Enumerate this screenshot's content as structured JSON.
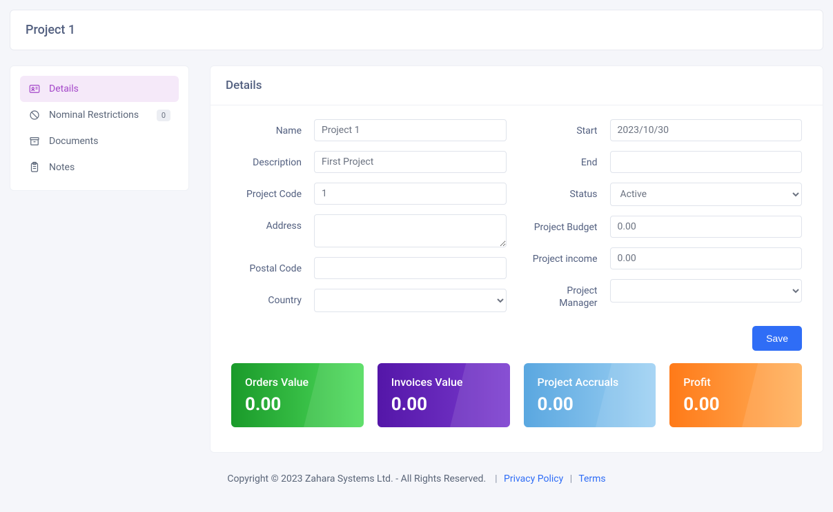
{
  "page_title": "Project 1",
  "sidebar": {
    "items": [
      {
        "label": "Details",
        "icon": "id-card-icon",
        "active": true
      },
      {
        "label": "Nominal Restrictions",
        "icon": "ban-icon",
        "badge": "0"
      },
      {
        "label": "Documents",
        "icon": "archive-icon"
      },
      {
        "label": "Notes",
        "icon": "clipboard-icon"
      }
    ]
  },
  "details": {
    "heading": "Details",
    "left": {
      "name_label": "Name",
      "name_value": "Project 1",
      "description_label": "Description",
      "description_value": "First Project",
      "project_code_label": "Project Code",
      "project_code_value": "1",
      "address_label": "Address",
      "address_value": "",
      "postal_code_label": "Postal Code",
      "postal_code_value": "",
      "country_label": "Country",
      "country_value": ""
    },
    "right": {
      "start_label": "Start",
      "start_value": "2023/10/30",
      "end_label": "End",
      "end_value": "",
      "status_label": "Status",
      "status_value": "Active",
      "status_options": [
        "Active"
      ],
      "budget_label": "Project Budget",
      "budget_value": "0.00",
      "income_label": "Project income",
      "income_value": "0.00",
      "manager_label": "Project Manager",
      "manager_value": ""
    },
    "save_label": "Save"
  },
  "stats": {
    "orders": {
      "label": "Orders Value",
      "value": "0.00"
    },
    "invoices": {
      "label": "Invoices Value",
      "value": "0.00"
    },
    "accruals": {
      "label": "Project Accruals",
      "value": "0.00"
    },
    "profit": {
      "label": "Profit",
      "value": "0.00"
    }
  },
  "footer": {
    "copyright": "Copyright © 2023 Zahara Systems Ltd. - All Rights Reserved.",
    "privacy": "Privacy Policy",
    "terms": "Terms"
  }
}
